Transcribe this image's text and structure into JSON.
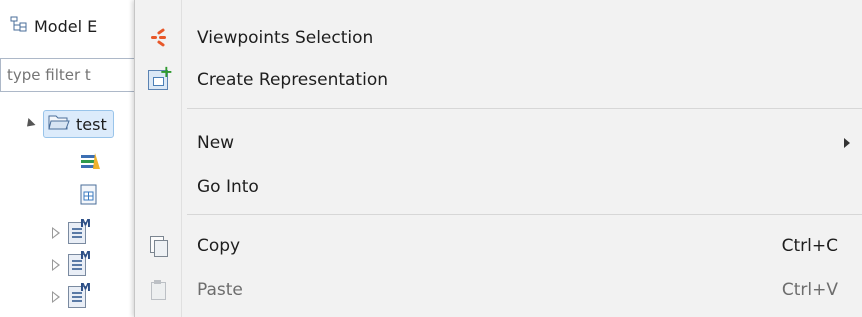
{
  "explorer": {
    "title": "Model E",
    "filter_placeholder": "type filter t",
    "root_label": "test"
  },
  "menu": {
    "items": [
      {
        "label": "Viewpoints Selection",
        "icon": "viewpoints-icon",
        "enabled": true
      },
      {
        "label": "Create Representation",
        "icon": "create-representation-icon",
        "enabled": true
      },
      {
        "label": "New",
        "has_submenu": true,
        "enabled": true
      },
      {
        "label": "Go Into",
        "enabled": true
      },
      {
        "label": "Copy",
        "accelerator": "Ctrl+C",
        "icon": "copy-icon",
        "enabled": true
      },
      {
        "label": "Paste",
        "accelerator": "Ctrl+V",
        "icon": "paste-icon",
        "enabled": false
      }
    ]
  },
  "colors": {
    "menu_background": "#f2f2f2",
    "viewpoints_accent": "#e8582a",
    "selection_highlight": "#dcebfb",
    "disabled_text": "#6d6d6d"
  }
}
